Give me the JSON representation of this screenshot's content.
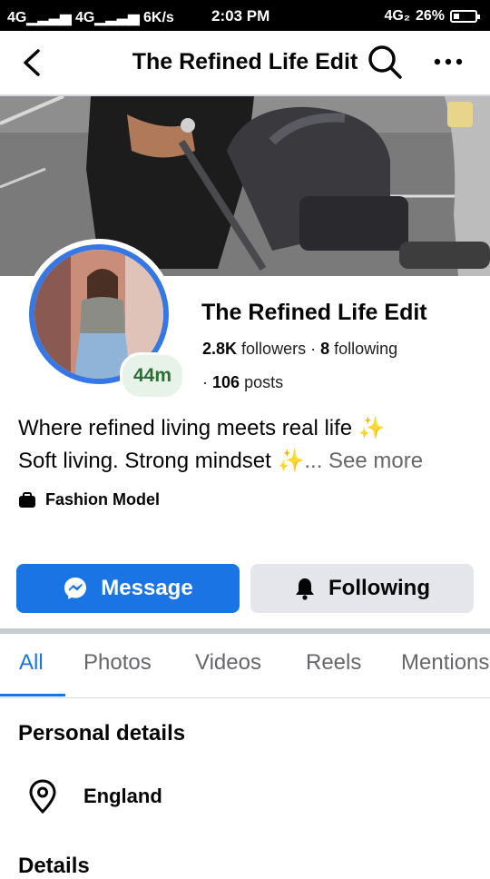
{
  "status_bar": {
    "signal": "4G▁▂▃▅ 4G▁▂▃▅",
    "speed": "6K/s",
    "time": "2:03 PM",
    "network": "4G₂",
    "battery": "26%"
  },
  "header": {
    "title": "The Refined Life Edit"
  },
  "profile": {
    "name": "The Refined Life Edit",
    "followers_count": "2.8K",
    "followers_label": "followers",
    "following_count": "8",
    "following_label": "following",
    "posts_count": "106",
    "posts_label": "posts",
    "story_age": "44m",
    "bio_line1": "Where refined living meets real life ✨",
    "bio_line2": "Soft living. Strong mindset ✨",
    "see_more": "... See more",
    "category": "Fashion Model"
  },
  "actions": {
    "message_label": "Message",
    "following_label": "Following"
  },
  "tabs": [
    {
      "label": "All",
      "active": true
    },
    {
      "label": "Photos"
    },
    {
      "label": "Videos"
    },
    {
      "label": "Reels"
    },
    {
      "label": "Mentions"
    }
  ],
  "personal_details": {
    "heading": "Personal details",
    "location": "England"
  },
  "details": {
    "heading": "Details"
  },
  "colors": {
    "accent": "#1b74e4",
    "secondary_button": "#e4e6eb",
    "story_ring": "#3578e5",
    "badge_bg": "#e7f3e8",
    "badge_text": "#2e6d34"
  },
  "icons": [
    "back-arrow-icon",
    "search-icon",
    "more-icon",
    "messenger-icon",
    "bell-icon",
    "briefcase-icon",
    "location-pin-icon"
  ]
}
